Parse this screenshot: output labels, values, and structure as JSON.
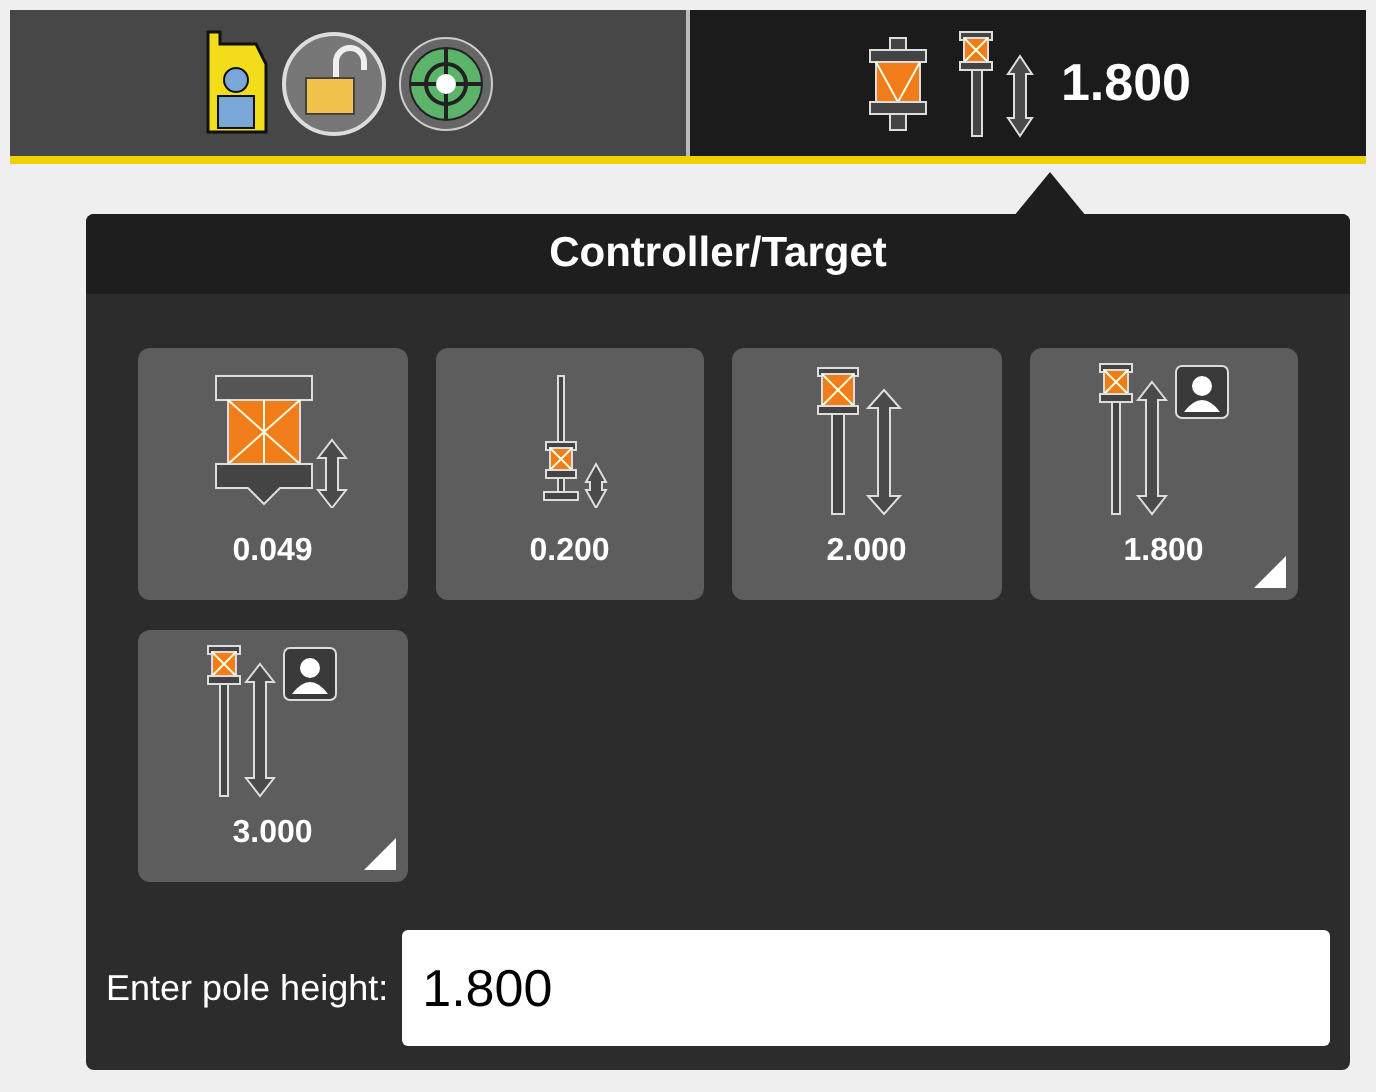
{
  "tabs": [
    {
      "kind": "status",
      "selected": false
    },
    {
      "kind": "target",
      "label": "1.800",
      "selected": true
    }
  ],
  "panel": {
    "title": "Controller/Target",
    "targets": [
      {
        "kind": "prism-large",
        "label": "0.049",
        "has_options": false
      },
      {
        "kind": "prism-mini",
        "label": "0.200",
        "has_options": false
      },
      {
        "kind": "pole",
        "label": "2.000",
        "has_options": false
      },
      {
        "kind": "pole-person",
        "label": "1.800",
        "has_options": true
      },
      {
        "kind": "pole-person",
        "label": "3.000",
        "has_options": true
      }
    ],
    "pole_height": {
      "label": "Enter pole height:",
      "value": "1.800"
    }
  }
}
